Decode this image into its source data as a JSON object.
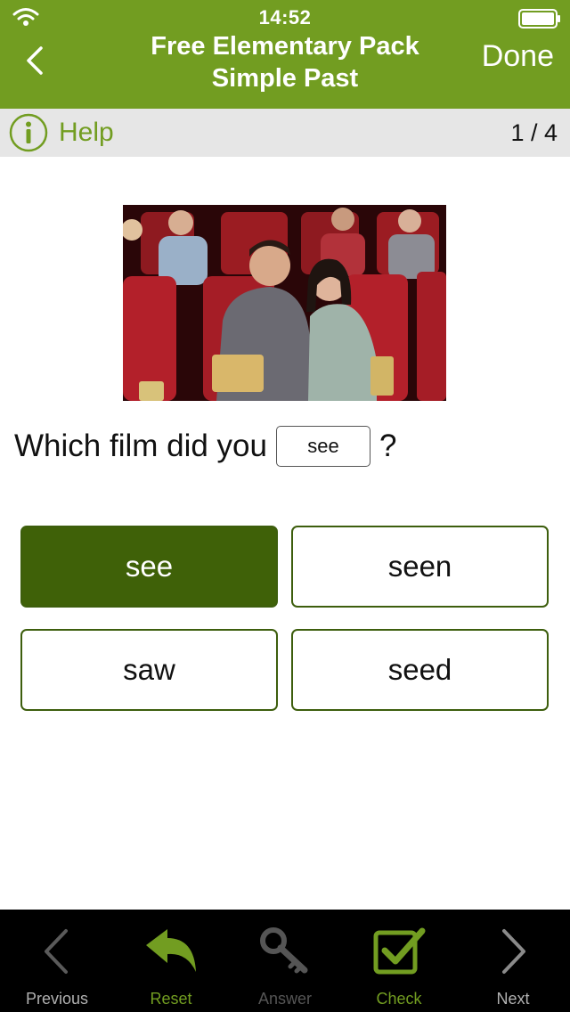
{
  "status_bar": {
    "time": "14:52"
  },
  "header": {
    "title_line1": "Free Elementary Pack",
    "title_line2": "Simple Past",
    "done_label": "Done"
  },
  "help_bar": {
    "help_label": "Help",
    "page_counter": "1 / 4"
  },
  "question": {
    "text_before": "Which film did you",
    "blank_value": "see",
    "text_after": "?"
  },
  "options": [
    {
      "label": "see",
      "selected": true
    },
    {
      "label": "seen",
      "selected": false
    },
    {
      "label": "saw",
      "selected": false
    },
    {
      "label": "seed",
      "selected": false
    }
  ],
  "tabs": [
    {
      "label": "Previous",
      "icon": "chevron-left-icon",
      "color": "#b0b0b0"
    },
    {
      "label": "Reset",
      "icon": "reset-arrow-icon",
      "color": "#729d21"
    },
    {
      "label": "Answer",
      "icon": "key-icon",
      "color": "#555555"
    },
    {
      "label": "Check",
      "icon": "checkbox-check-icon",
      "color": "#729d21"
    },
    {
      "label": "Next",
      "icon": "chevron-right-icon",
      "color": "#b0b0b0"
    }
  ],
  "colors": {
    "brand_green": "#729d21",
    "selected_option": "#3f6108",
    "help_bar_bg": "#e6e6e6",
    "tab_bar_bg": "#000000"
  }
}
